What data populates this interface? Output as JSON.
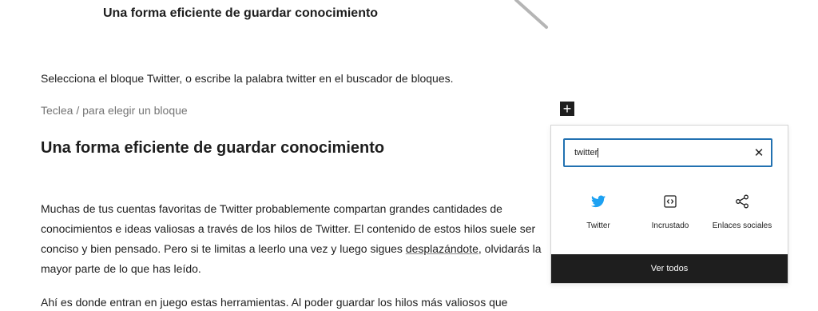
{
  "page": {
    "top_heading": "Una forma eficiente de guardar conocimiento",
    "intro_paragraph": "Selecciona el bloque Twitter, o escribe la palabra twitter en el buscador de bloques.",
    "block_placeholder": "Teclea / para elegir un bloque",
    "section_heading": "Una forma eficiente de guardar conocimiento",
    "body_part1": "Muchas de tus cuentas favoritas de Twitter probablemente compartan grandes cantidades de conocimientos e ideas valiosas a través de los hilos de Twitter. El contenido de estos hilos suele ser conciso y bien pensado. Pero si te limitas a leerlo una vez y luego sigues ",
    "body_link": "desplazándote",
    "body_part2": ", olvidarás la mayor parte de lo que has leído.",
    "last_paragraph": "Ahí es donde entran en juego estas herramientas. Al poder guardar los hilos más valiosos que"
  },
  "inserter": {
    "search_value": "twitter",
    "results": [
      {
        "label": "Twitter",
        "icon": "twitter-icon",
        "color": "#1da1f2"
      },
      {
        "label": "Incrustado",
        "icon": "embed-icon",
        "color": "#1e1e1e"
      },
      {
        "label": "Enlaces sociales",
        "icon": "share-icon",
        "color": "#1e1e1e"
      }
    ],
    "view_all_label": "Ver todos"
  },
  "colors": {
    "accent": "#2271b1",
    "dark": "#1e1e1e",
    "muted": "#757575"
  }
}
